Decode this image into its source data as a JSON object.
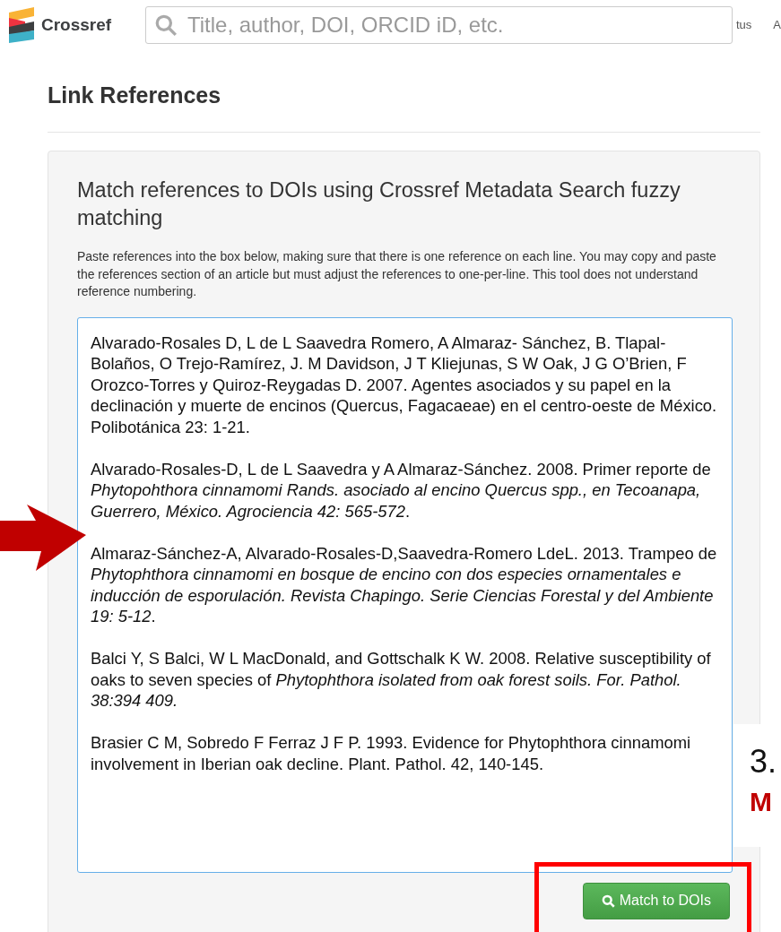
{
  "header": {
    "logo_text": "Crossref",
    "search": {
      "placeholder": "Title, author, DOI, ORCID iD, etc."
    },
    "nav": [
      "tus",
      "A"
    ]
  },
  "page_title": "Link References",
  "panel": {
    "heading": "Match references to DOIs using Crossref Metadata Search fuzzy matching",
    "description": "Paste references into the box below, making sure that there is one reference on each line. You may copy and paste the references section of an article but must adjust the references to one-per-line. This tool does not understand reference numbering.",
    "references": [
      "Alvarado-Rosales D, L de L Saavedra Romero, A Almaraz- Sánchez, B. Tlapal-Bolaños, O Trejo-Ramírez, J. M Davidson, J T Kliejunas, S W Oak, J G O’Brien, F Orozco-Torres y Quiroz-Reygadas D. 2007. Agentes asociados y su papel en la declinación y muerte de encinos (Quercus, Fagacaeae) en el centro-oeste de México. Polibotánica 23: 1-21.",
      "Alvarado-Rosales-D, L de L Saavedra y A Almaraz-Sánchez. 2008. Primer reporte de *Phytopohthora cinnamomi Rands. asociado al encino Quercus spp., en Tecoanapa, Guerrero, México. Agrociencia 42: 565-572*.",
      "Almaraz-Sánchez-A, Alvarado-Rosales-D,Saavedra-Romero LdeL. 2013. Trampeo de *Phytophthora cinnamomi en bosque de encino con dos especies ornamentales e inducción de esporulación. Revista Chapingo. Serie Ciencias Forestal y del Ambiente 19: 5-12*.",
      "Balci Y, S Balci, W L MacDonald, and Gottschalk K W. 2008. Relative susceptibility of oaks to seven species of *Phytophthora isolated from oak forest soils. For. Pathol. 38:394 409.*",
      "Brasier C M, Sobredo F Ferraz J F P. 1993. Evidence for Phytophthora cinnamomi involvement in Iberian oak decline. Plant. Pathol. 42, 140-145."
    ],
    "button": "Match to DOIs"
  },
  "annotation": {
    "number": "3.",
    "word": "M"
  }
}
